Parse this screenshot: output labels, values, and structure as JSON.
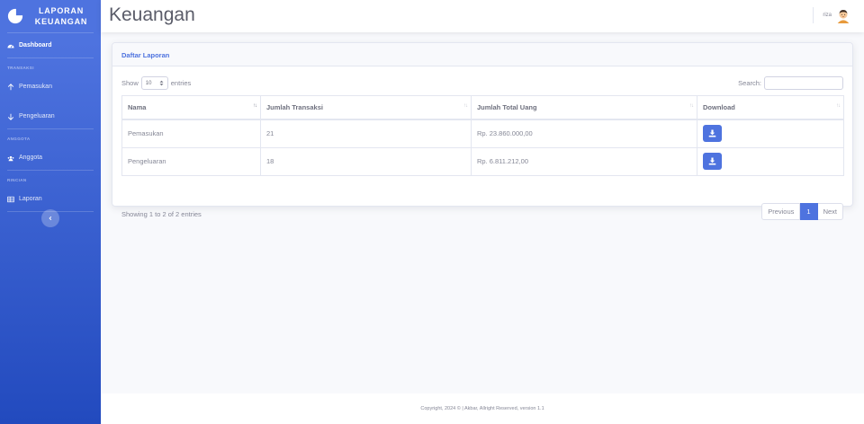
{
  "sidebar": {
    "brand_line1": "LAPORAN",
    "brand_line2": "KEUANGAN",
    "dashboard_label": "Dashboard",
    "heading_transaksi": "TRANSAKSI",
    "pemasukan_label": "Pemasukan",
    "pengeluaran_label": "Pengeluaran",
    "heading_anggota": "ANGGOTA",
    "anggota_label": "Anggota",
    "heading_rincian": "RINCIAN",
    "laporan_label": "Laporan",
    "toggle_icon": "chevron-left-icon"
  },
  "topbar": {
    "title": "Keuangan",
    "user_name": "riza",
    "avatar_icon": "user-avatar-icon"
  },
  "card": {
    "header": "Daftar Laporan",
    "show_label": "Show",
    "page_length": "10",
    "entries_label": "entries",
    "search_label": "Search:",
    "search_value": ""
  },
  "table": {
    "columns": [
      "Nama",
      "Jumlah Transaksi",
      "Jumlah Total Uang",
      "Download"
    ],
    "rows": [
      {
        "nama": "Pemasukan",
        "jumlah_transaksi": "21",
        "jumlah_total_uang": "Rp. 23.860.000,00",
        "download_icon": "download-icon"
      },
      {
        "nama": "Pengeluaran",
        "jumlah_transaksi": "18",
        "jumlah_total_uang": "Rp. 6.811.212,00",
        "download_icon": "download-icon"
      }
    ]
  },
  "pagination": {
    "info": "Showing 1 to 2 of 2 entries",
    "previous": "Previous",
    "current_page": "1",
    "next": "Next"
  },
  "footer": {
    "text": "Copyright, 2024 © | Akbar, Allright Reserved, version 1.1"
  },
  "colors": {
    "primary": "#4e73df",
    "sidebar_gradient_end": "#224abe",
    "text_muted": "#858796",
    "background": "#f8f9fc"
  }
}
